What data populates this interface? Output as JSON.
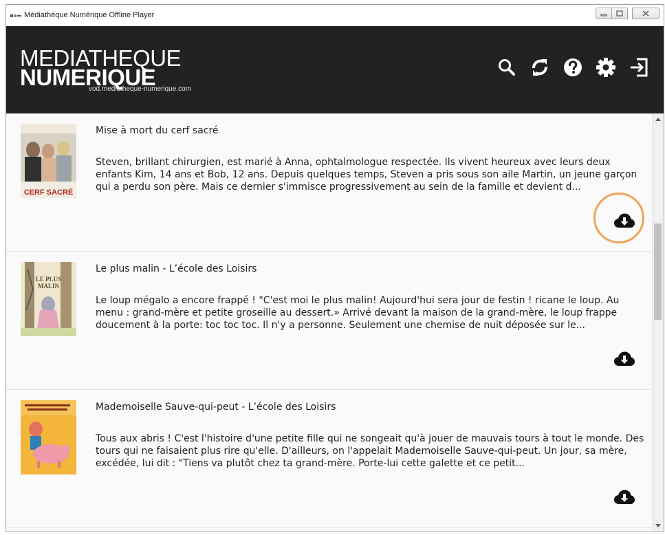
{
  "window": {
    "title": "Médiathèque Numérique Offline Player",
    "controls": [
      "minimize-icon",
      "maximize-icon",
      "close-icon"
    ]
  },
  "header": {
    "logo_line1": "MEDIATHEQUE",
    "logo_line2": "NUMERIQUE",
    "logo_url": "vod.mediatheque-numerique.com",
    "icons": [
      "search-icon",
      "sync-icon",
      "help-icon",
      "gear-icon",
      "exit-icon"
    ]
  },
  "items": [
    {
      "title": "Mise à mort du cerf sacré",
      "description": "Steven, brillant chirurgien, est marié à Anna, ophtalmologue respectée. Ils vivent heureux avec leurs deux enfants Kim, 14 ans et Bob, 12 ans. Depuis quelques temps, Steven a pris sous son aile Martin, un jeune garçon qui a perdu son père. Mais ce dernier s'immisce progressivement au sein de la famille et devient d...",
      "cover_text": "CERF SACRÉ",
      "highlighted": true
    },
    {
      "title": "Le plus malin - L’école des Loisirs",
      "description": "Le loup mégalo a encore frappé !   \"C'est moi le plus malin! Aujourd'hui sera jour de festin ! ricane le loup. Au menu : grand-mère et petite groseille au dessert.» Arrivé devant la maison de la grand-mère, le loup frappe doucement à la porte: toc toc toc. Il n'y a personne. Seulement une chemise de nuit déposée sur le...",
      "cover_text": "LE PLUS MALIN",
      "highlighted": false
    },
    {
      "title": "Mademoiselle Sauve-qui-peut - L’école des Loisirs",
      "description": "Tous aux abris !   C'est l'histoire d'une petite fille qui ne songeait qu'à jouer de mauvais tours à tout le monde. Des tours qui ne faisaient plus rire qu'elle. D'ailleurs, on l'appelait Mademoiselle Sauve-qui-peut. Un jour, sa mère, excédée, lui dit : \"Tiens va plutôt chez ta grand-mère. Porte-lui cette galette et ce petit...",
      "cover_text": "",
      "highlighted": false
    }
  ],
  "colors": {
    "header_bg": "#222222",
    "content_bg": "#fafafa",
    "highlight_ring": "#f0a25a"
  }
}
